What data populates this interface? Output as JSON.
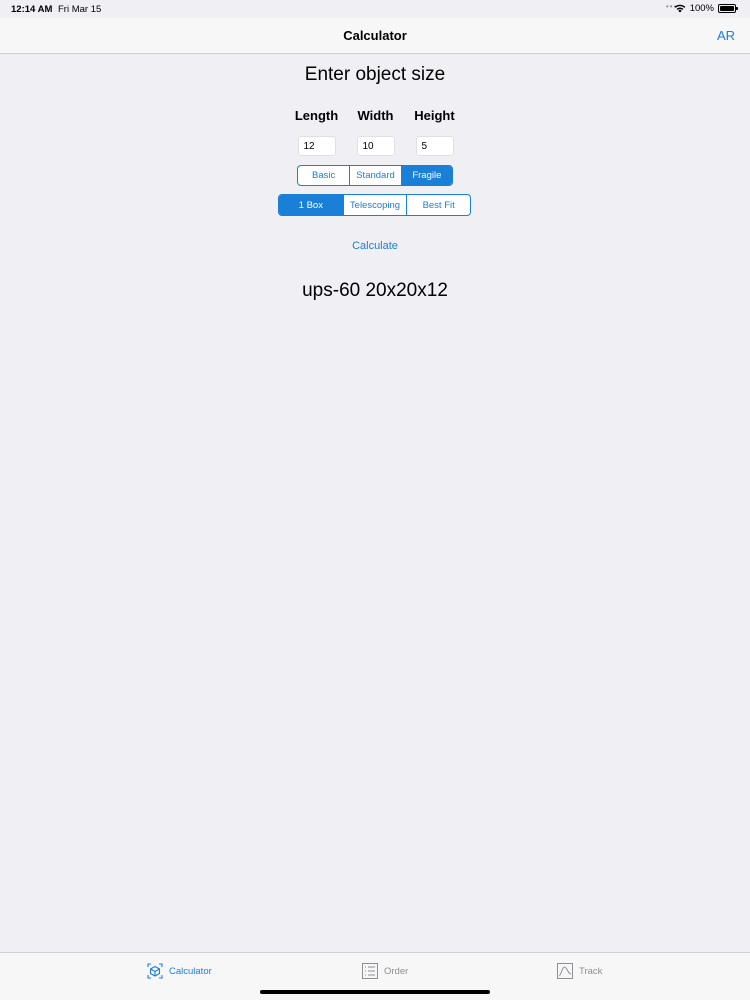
{
  "status_bar": {
    "time": "12:14 AM",
    "date": "Fri Mar 15",
    "battery": "100%"
  },
  "nav": {
    "title": "Calculator",
    "right_button": "AR"
  },
  "main": {
    "heading": "Enter object size",
    "dimensions": [
      {
        "label": "Length",
        "value": "12"
      },
      {
        "label": "Width",
        "value": "10"
      },
      {
        "label": "Height",
        "value": "5"
      }
    ],
    "packing_options": [
      "Basic",
      "Standard",
      "Fragile"
    ],
    "packing_selected": "Fragile",
    "box_options": [
      "1 Box",
      "Telescoping",
      "Best Fit"
    ],
    "box_selected": "1 Box",
    "calculate_label": "Calculate",
    "result": "ups-60 20x20x12"
  },
  "tab_bar": {
    "items": [
      {
        "label": "Calculator",
        "icon": "cube-icon",
        "active": true
      },
      {
        "label": "Order",
        "icon": "list-icon",
        "active": false
      },
      {
        "label": "Track",
        "icon": "chart-icon",
        "active": false
      }
    ]
  },
  "colors": {
    "accent": "#1a7fd6",
    "background": "#efeff4",
    "inactive": "#8e8e93"
  }
}
